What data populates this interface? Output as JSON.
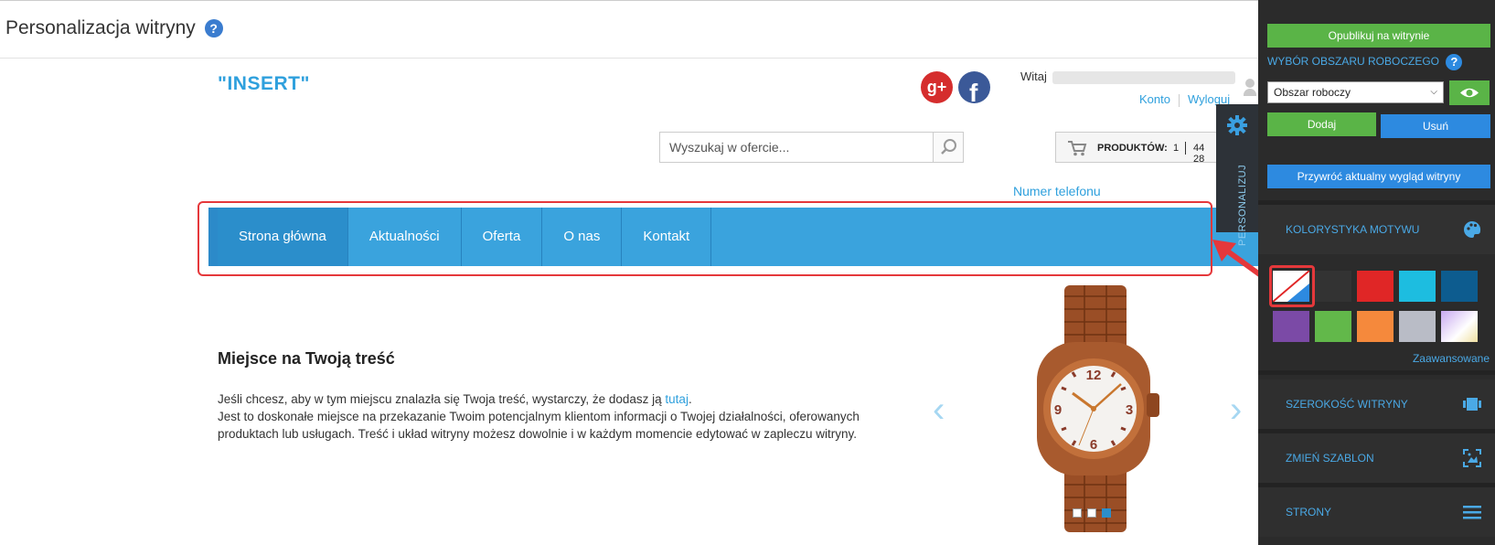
{
  "header": {
    "title": "Personalizacja witryny",
    "help": "?"
  },
  "site": {
    "logo": "\"INSERT\"",
    "social": {
      "gplus": "g+",
      "facebook": "f"
    },
    "welcome": "Witaj",
    "links": {
      "account": "Konto",
      "logout": "Wyloguj"
    },
    "search_placeholder": "Wyszukaj w ofercie...",
    "cart": {
      "label": "PRODUKTÓW:",
      "count": "1",
      "price": "44 28"
    },
    "phone": "Numer telefonu",
    "nav": [
      "Strona główna",
      "Aktualności",
      "Oferta",
      "O nas",
      "Kontakt"
    ],
    "content_title": "Miejsce na Twoją treść",
    "content_line1": "Jeśli chcesz, aby w tym miejscu znalazła się Twoja treść, wystarczy, że dodasz ją ",
    "content_link": "tutaj",
    "content_line1_end": ".",
    "content_line2": "Jest to doskonałe miejsce na przekazanie Twoim potencjalnym klientom informacji o Twojej działalności, oferowanych produktach lub usługach. Treść i układ witryny możesz dowolnie i w każdym momencie edytować w zapleczu witryny.",
    "slider": {
      "prev": "‹",
      "next": "›",
      "active_slide": 3,
      "slides": 3
    }
  },
  "personalize_tab": {
    "label": "PERSONALIZUJ"
  },
  "panel": {
    "publish": "Opublikuj na witrynie",
    "workspace_label": "WYBÓR OBSZARU ROBOCZEGO",
    "workspace_value": "Obszar roboczy",
    "add": "Dodaj",
    "delete": "Usuń",
    "restore": "Przywróć aktualny wygląd witryny",
    "color_section": "KOLORYSTYKA MOTYWU",
    "advanced": "Zaawansowane",
    "width_section": "SZEROKOŚĆ WITRYNY",
    "template_section": "ZMIEŃ SZABLON",
    "pages_section": "STRONY",
    "swatches": [
      "#ffffff",
      "#333333",
      "#e02626",
      "#1dbde0",
      "#0d5c8f",
      "#7b4aa6",
      "#62b84a",
      "#f5893c",
      "#b9bcc6",
      "#d7c4ef"
    ]
  },
  "colors": {
    "accent": "#3aa3dd",
    "green": "#5ab447",
    "blue": "#2d8ae0",
    "highlight": "#e5383b"
  }
}
